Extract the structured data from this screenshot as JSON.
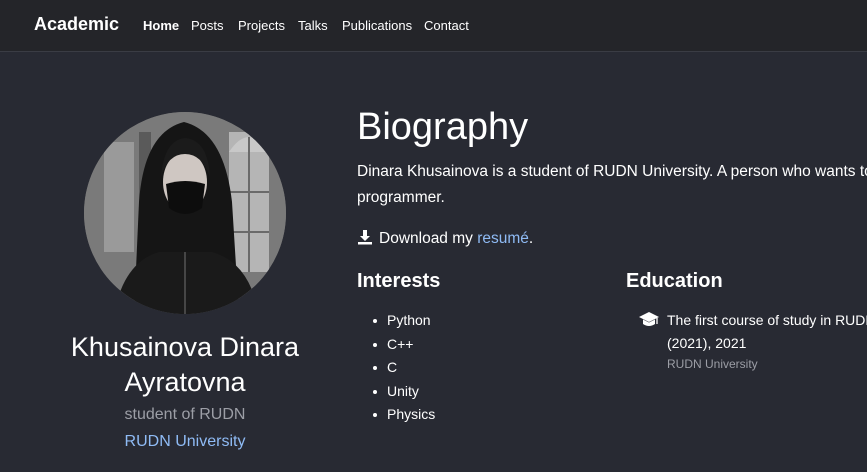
{
  "nav": {
    "brand": "Academic",
    "items": [
      {
        "label": "Home",
        "active": true
      },
      {
        "label": "Posts"
      },
      {
        "label": "Projects"
      },
      {
        "label": "Talks"
      },
      {
        "label": "Publications"
      },
      {
        "label": "Contact"
      }
    ]
  },
  "profile": {
    "name": "Khusainova Dinara Ayratovna",
    "role": "student of RUDN",
    "organization": "RUDN University"
  },
  "biography": {
    "title": "Biography",
    "lines": [
      "Dinara Khusainova is a student of RUDN University. A person who wants to",
      "programmer."
    ],
    "download_prefix": "Download my ",
    "download_link": "resumé",
    "download_suffix": "."
  },
  "interests": {
    "title": "Interests",
    "items": [
      "Python",
      "C++",
      "C",
      "Unity",
      "Physics"
    ]
  },
  "education": {
    "title": "Education",
    "course_lines": [
      "The first course of study in RUDN",
      "(2021), 2021"
    ],
    "institution": "RUDN University"
  },
  "colors": {
    "background": "#282a33",
    "navbar": "#242529",
    "link": "#8fbbf5",
    "muted": "#9c9ea6"
  },
  "icons": [
    "download-icon",
    "graduation-cap-icon"
  ]
}
